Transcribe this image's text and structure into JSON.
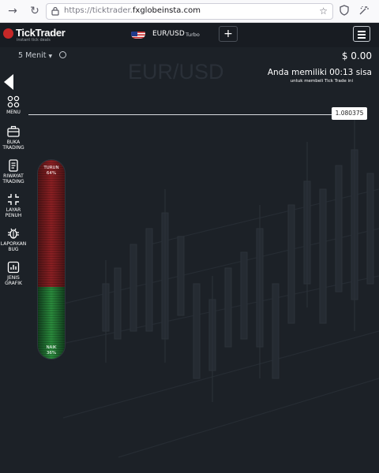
{
  "browser": {
    "url_prefix": "https://ticktrader.",
    "url_domain": "fxglobeinsta.com",
    "icons": [
      "back-icon",
      "forward-icon",
      "reload-icon",
      "lock-icon",
      "bookmark-star-icon",
      "shield-icon",
      "extensions-icon"
    ]
  },
  "app": {
    "logo_text": "TickTrader",
    "logo_tagline": "instant tick deals",
    "pair": "EUR/USD",
    "mode": "Turbo",
    "add_label": "+",
    "flag_icon": "us-flag-icon",
    "menu_icon": "hamburger-icon"
  },
  "chart": {
    "watermark": "EUR/USD",
    "timeframe": "5 Menit",
    "balance": "$ 0.00",
    "remaining": "Anda memiliki 00:13 sisa",
    "remaining_sub": "untuk membeli Tick Trade ini",
    "price": "1.080375"
  },
  "sidebar": {
    "items": [
      {
        "label1": "MENU",
        "label2": "",
        "icon": "grid-icon"
      },
      {
        "label1": "BUKA",
        "label2": "TRADING",
        "icon": "briefcase-icon"
      },
      {
        "label1": "RIWAYAT",
        "label2": "TRADING",
        "icon": "document-icon"
      },
      {
        "label1": "LAYAR",
        "label2": "PENUH",
        "icon": "fullscreen-exit-icon"
      },
      {
        "label1": "LAPORKAN",
        "label2": "BUG",
        "icon": "bug-icon"
      },
      {
        "label1": "JENIS",
        "label2": "GRAFIK",
        "icon": "chart-type-icon"
      }
    ]
  },
  "sentiment": {
    "down_label": "TURUN",
    "down_pct": "64%",
    "up_label": "NAIK",
    "up_pct": "36%",
    "down_fraction": 0.64,
    "up_fraction": 0.36
  },
  "colors": {
    "background": "#1c2127",
    "down": "#8a1f22",
    "up": "#2a8a3c",
    "logo_red": "#c62828"
  }
}
